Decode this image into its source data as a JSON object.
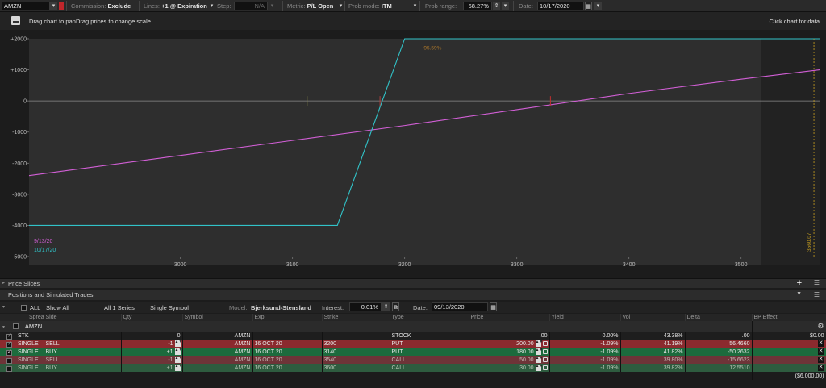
{
  "toolbar": {
    "symbol": "AMZN",
    "commission_label": "Commission:",
    "commission_value": "Exclude",
    "lines_label": "Lines:",
    "lines_value": "+1 @ Expiration",
    "step_label": "Step:",
    "step_value": "N/A",
    "metric_label": "Metric:",
    "metric_value": "P/L Open",
    "prob_mode_label": "Prob mode:",
    "prob_mode_value": "ITM",
    "prob_range_label": "Prob range:",
    "prob_range_value": "68.27%",
    "date_label": "Date:",
    "date_value": "10/17/2020"
  },
  "hint": {
    "left": "Drag chart to panDrag prices to change scale",
    "right": "Click chart for data"
  },
  "chart_data": {
    "type": "line",
    "xlim": [
      2865,
      3570
    ],
    "ylim": [
      -5000,
      2000
    ],
    "x_ticks": [
      3000,
      3100,
      3200,
      3300,
      3400,
      3500
    ],
    "y_ticks": [
      2000,
      1000,
      0,
      -1000,
      -2000,
      -3000,
      -4000,
      -5000
    ],
    "y_tick_labels": [
      "+2000",
      "+1000",
      "0",
      "-1000",
      "-2000",
      "-3000",
      "-4000",
      "-5000"
    ],
    "series": [
      {
        "name": "9/13/20",
        "color": "#d25fd6",
        "x": [
          2865,
          3000,
          3100,
          3200,
          3300,
          3400,
          3500,
          3570
        ],
        "y": [
          -2400,
          -1750,
          -1270,
          -790,
          -280,
          240,
          700,
          1000
        ]
      },
      {
        "name": "10/17/20",
        "color": "#31c3c8",
        "x": [
          2865,
          3140,
          3200,
          3570
        ],
        "y": [
          -4000,
          -4000,
          2000,
          2000
        ]
      }
    ],
    "annotations": {
      "prob_label": "95.59%",
      "price_marker": "3560.07"
    }
  },
  "price_slices": {
    "label": "Price Slices"
  },
  "positions": {
    "label": "Positions and Simulated Trades",
    "options": {
      "all_label": "ALL",
      "show_all": "Show All",
      "series": "All 1 Series",
      "single_symbol": "Single Symbol",
      "model_label": "Model:",
      "model_value": "Bjerksund-Stensland",
      "interest_label": "Interest:",
      "interest_value": "0.01%",
      "date_label": "Date:",
      "date_value": "09/13/2020"
    },
    "headers": [
      "Spread",
      "Side",
      "Qty",
      "Symbol",
      "Exp",
      "Strike",
      "Type",
      "Price",
      "Yield",
      "Vol",
      "Delta",
      "BP Effect"
    ],
    "group": "AMZN",
    "rows": [
      {
        "spread": "STK",
        "side": "",
        "qty": "0",
        "symbol": "AMZN",
        "exp": "",
        "strike": "",
        "type": "STOCK",
        "price": ".00",
        "yield": "0.00%",
        "vol": "43.38%",
        "delta": ".00",
        "bp": "$0.00"
      },
      {
        "spread": "SINGLE",
        "side": "SELL",
        "qty": "-1",
        "symbol": "AMZN",
        "exp": "16 OCT 20",
        "strike": "3200",
        "type": "PUT",
        "price": "200.00",
        "yield": "-1.09%",
        "vol": "41.19%",
        "delta": "56.4660",
        "bp": ""
      },
      {
        "spread": "SINGLE",
        "side": "BUY",
        "qty": "+1",
        "symbol": "AMZN",
        "exp": "16 OCT 20",
        "strike": "3140",
        "type": "PUT",
        "price": "180.00",
        "yield": "-1.09%",
        "vol": "41.82%",
        "delta": "-50.2632",
        "bp": ""
      },
      {
        "spread": "SINGLE",
        "side": "SELL",
        "qty": "-1",
        "symbol": "AMZN",
        "exp": "16 OCT 20",
        "strike": "3540",
        "type": "CALL",
        "price": "50.00",
        "yield": "-1.09%",
        "vol": "39.80%",
        "delta": "-15.6623",
        "bp": ""
      },
      {
        "spread": "SINGLE",
        "side": "BUY",
        "qty": "+1",
        "symbol": "AMZN",
        "exp": "16 OCT 20",
        "strike": "3600",
        "type": "CALL",
        "price": "30.00",
        "yield": "-1.09%",
        "vol": "39.82%",
        "delta": "12.5510",
        "bp": ""
      }
    ],
    "total_bp": "($6,000.00)"
  },
  "colors": {
    "sell_row": "#8b2a2e",
    "buy_row": "#1c6b3d",
    "line_today": "#d25fd6",
    "line_expiration": "#31c3c8"
  }
}
